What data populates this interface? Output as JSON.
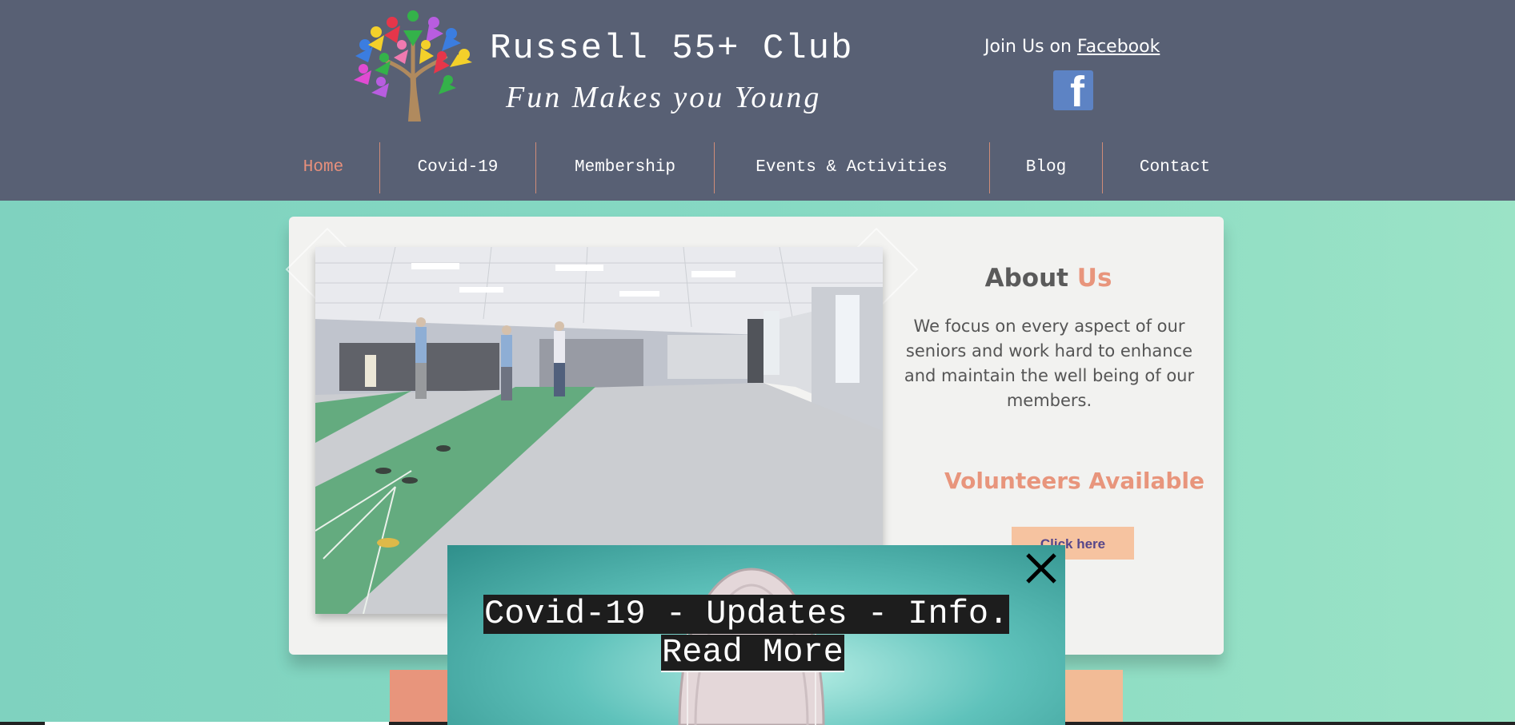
{
  "header": {
    "title": "Russell 55+ Club",
    "tagline": "Fun Makes you Young",
    "facebook_prefix": "Join Us on ",
    "facebook_link": "Facebook",
    "facebook_icon": "facebook-icon",
    "logo_icon": "tree-logo-icon",
    "background_color": "#586074"
  },
  "nav": {
    "items": [
      {
        "label": "Home",
        "active": true
      },
      {
        "label": "Covid-19"
      },
      {
        "label": "Membership"
      },
      {
        "label": "Events & Activities"
      },
      {
        "label": "Blog"
      },
      {
        "label": "Contact"
      }
    ],
    "active_color": "#e8907c"
  },
  "about": {
    "title_main": "About",
    "title_accent": "Us",
    "text": "We focus on every aspect of our seniors and work hard to enhance and maintain the well being of our members.",
    "volunteers": "Volunteers  Available",
    "button_label": "Click here",
    "accent_color": "#e8957c"
  },
  "popup": {
    "line1": "Covid-19 - Updates - Info.",
    "line2": "Read More",
    "close_icon": "close-icon"
  }
}
